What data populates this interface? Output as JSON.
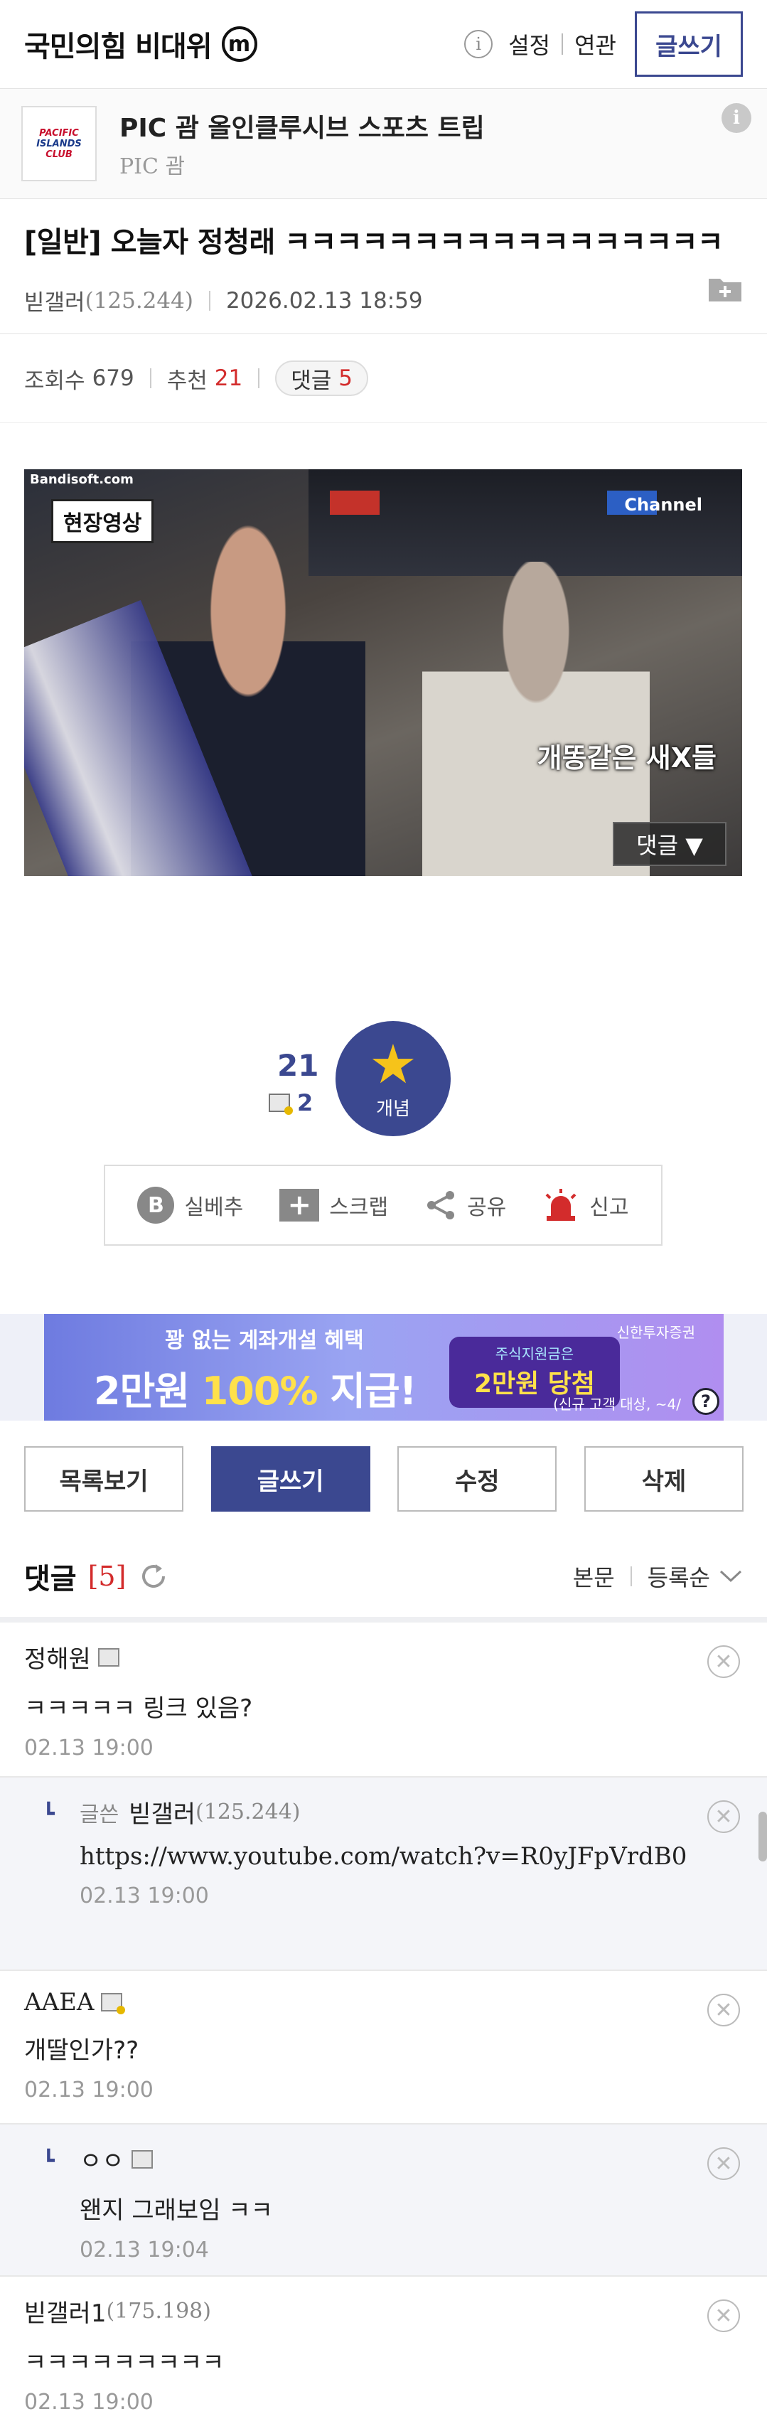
{
  "header": {
    "gallery_title": "국민의힘 비대위",
    "minor_badge": "m",
    "info_icon": "i",
    "nav": [
      "설정",
      "연관"
    ],
    "write_label": "글쓰기"
  },
  "ad": {
    "logo_line1": "PACIFIC",
    "logo_line2": "ISLANDS",
    "logo_line3": "CLUB",
    "title": "PIC 괌 올인클루시브 스포츠 트립",
    "subtitle": "PIC 괌",
    "info": "i"
  },
  "post": {
    "category": "[일반]",
    "title": "오늘자 정청래 ㅋㅋㅋㅋㅋㅋㅋㅋㅋㅋㅋㅋㅋㅋㅋㅋㅋ",
    "author": "빋갤러",
    "author_ip": "(125.244)",
    "datetime": "2026.02.13 18:59"
  },
  "stats": {
    "views_label": "조회수",
    "views": "679",
    "recommend_label": "추천",
    "recommend": "21",
    "comments_label": "댓글",
    "comments": "5"
  },
  "video": {
    "source": "Bandisoft.com",
    "badge": "현장영상",
    "channel": "Channel",
    "caption": "개똥같은 새X들",
    "comment_button": "댓글 ▼"
  },
  "recommend_box": {
    "count": "21",
    "fixed_count": "2",
    "button_label": "개념"
  },
  "tools": [
    {
      "label": "실베추",
      "icon": "b-icon"
    },
    {
      "label": "스크랩",
      "icon": "plus-icon"
    },
    {
      "label": "공유",
      "icon": "share-icon"
    },
    {
      "label": "신고",
      "icon": "siren-icon"
    }
  ],
  "banner": {
    "top_text": "꽝 없는 계좌개설 혜택",
    "main_text_a": "2만원 ",
    "main_text_b": "100%",
    "main_text_c": " 지급!",
    "brand": "신한투자증권",
    "pill_top": "주식지원금은",
    "pill_main": "2만원 당첨",
    "note": "(신규 고객 대상, ~4/",
    "help": "?"
  },
  "actions": {
    "list": "목록보기",
    "write": "글쓰기",
    "edit": "수정",
    "delete": "삭제"
  },
  "comment_header": {
    "title": "댓글",
    "count": "[5]",
    "sort_body": "본문",
    "sort_order": "등록순"
  },
  "comments": [
    {
      "name": "정해원",
      "ip": "",
      "text": "ㅋㅋㅋㅋㅋ 링크 있음?",
      "date": "02.13 19:00"
    },
    {
      "tag": "글쓴",
      "name": "빋갤러",
      "ip": "(125.244)",
      "text": "https://www.youtube.com/watch?v=R0yJFpVrdB0",
      "date": "02.13 19:00"
    },
    {
      "name": "AAEA",
      "ip": "",
      "text": "개딸인가??",
      "date": "02.13 19:00"
    },
    {
      "name": "ㅇㅇ",
      "ip": "",
      "text": "왠지 그래보임 ㅋㅋ",
      "date": "02.13 19:04"
    },
    {
      "name": "빋갤러1",
      "ip": "(175.198)",
      "text": "ㅋㅋㅋㅋㅋㅋㅋㅋㅋ",
      "date": "02.13 19:00"
    }
  ],
  "colors": {
    "accent": "#3b4890",
    "red": "#d32c2c"
  }
}
